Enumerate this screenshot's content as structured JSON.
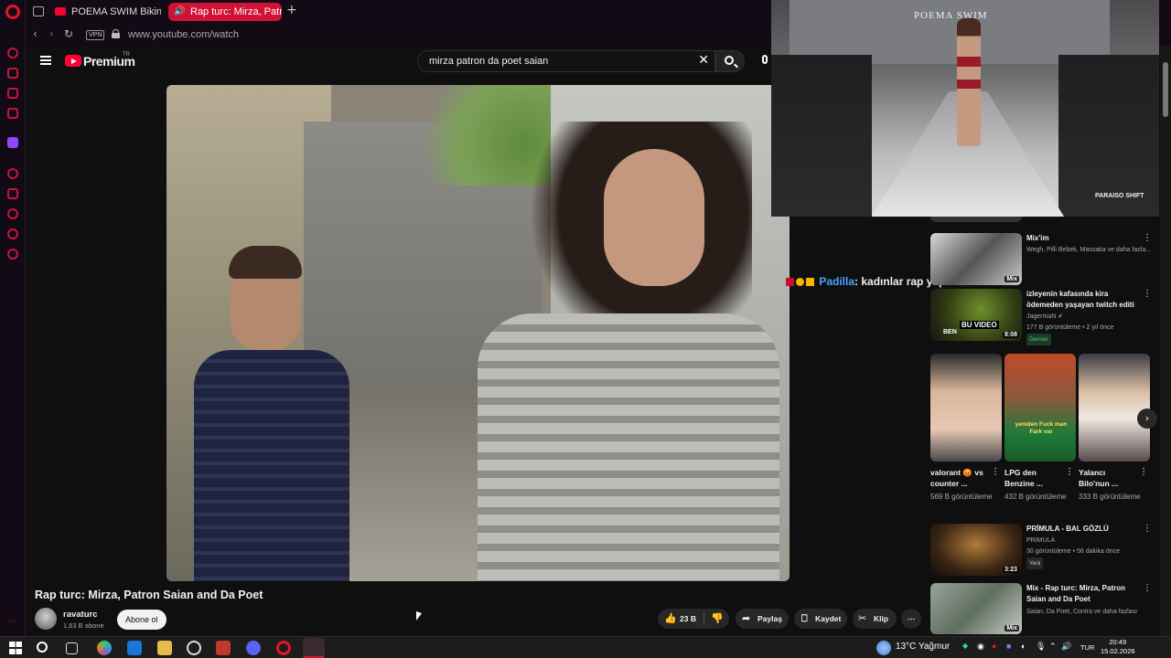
{
  "browser": {
    "tabs": [
      {
        "label": "POEMA SWIM Bikini Fashi"
      },
      {
        "label": "Rap turc: Mirza, Patron"
      }
    ],
    "new_tab": "+",
    "vpn": "VPN",
    "url": "www.youtube.com/watch"
  },
  "youtube": {
    "brand": "Premium",
    "region": "TR",
    "search_value": "mirza patron da poet saian"
  },
  "video": {
    "title": "Rap turc: Mirza, Patron Saian and Da Poet",
    "channel": "ravaturc",
    "subscribers": "1,63 B abone",
    "subscribe_label": "Abone ol",
    "likes": "23 B",
    "share_label": "Paylaş",
    "save_label": "Kaydet",
    "clip_label": "Klip"
  },
  "chat": {
    "user": "Padilla",
    "message": ": kadınlar rap yapmasın"
  },
  "pip": {
    "brand": "POEMA SWIM",
    "watermark": "PARAISO SHIFT"
  },
  "recommendations": {
    "mix1": {
      "title": "Mix'im",
      "meta": "Wegh, Pilli Bebek, Massaka ve daha fazla...",
      "badge": "Mix"
    },
    "jagerman": {
      "title": "izleyenin kafasında kira ödemeden yaşayan twitch editi",
      "channel": "JagermaN",
      "meta": "177 B görüntüleme • 2 yıl önce",
      "tag": "Demek",
      "duration": "8:08",
      "thumb_text": "BU VIDEO",
      "thumb_text2": "BEN"
    },
    "shorts": [
      {
        "title": "valorant 😡 vs counter ...",
        "views": "569 B görüntüleme"
      },
      {
        "title": "LPG den Benzine ...",
        "views": "432 B görüntüleme",
        "thumb_text": "yeniden Fuck man Fark var"
      },
      {
        "title": "Yalancı Bilo'nun ...",
        "views": "333 B görüntüleme"
      }
    ],
    "primula": {
      "title": "PRİMULA - BAL GÖZLÜ",
      "channel": "PRIMULA",
      "meta": "30 görüntüleme • 56 dakika önce",
      "tag": "Yeni",
      "duration": "3:23"
    },
    "mix2": {
      "title": "Mix - Rap turc: Mirza, Patron Saian and Da Poet",
      "meta": "Saian, Da Poet, Contra ve daha fazlası",
      "badge": "Mix"
    }
  },
  "taskbar": {
    "weather": "13°C  Yağmur",
    "language": "TUR",
    "time": "20:49",
    "date": "15.02.2026"
  }
}
